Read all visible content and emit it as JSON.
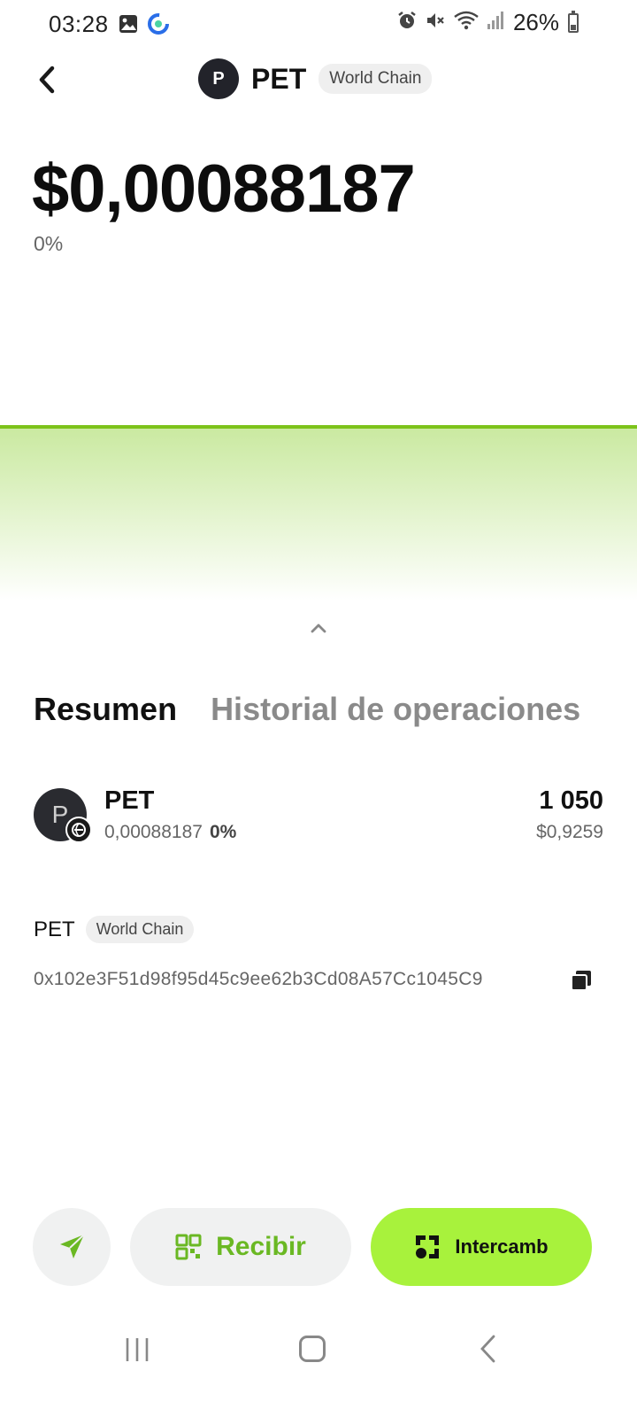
{
  "status_bar": {
    "time": "03:28",
    "battery": "26%",
    "icons": [
      "gallery-icon",
      "app-loader-icon",
      "alarm-icon",
      "mute-icon",
      "wifi-icon",
      "signal-icon",
      "battery-icon"
    ]
  },
  "header": {
    "avatar_letter": "P",
    "title": "PET",
    "chain": "World Chain"
  },
  "price": {
    "value": "$0,00088187",
    "change": "0%"
  },
  "chart": {
    "line_color": "#7cc31a",
    "fill_color": "#c7e89b",
    "trend": "flat"
  },
  "tabs": [
    {
      "label": "Resumen",
      "active": true
    },
    {
      "label": "Historial de operaciones",
      "active": false
    }
  ],
  "token": {
    "avatar_letter": "P",
    "name": "PET",
    "price": "0,00088187",
    "change": "0%",
    "amount": "1 050",
    "fiat": "$0,9259"
  },
  "contract": {
    "symbol": "PET",
    "chain": "World Chain",
    "address": "0x102e3F51d98f95d45c9ee62b3Cd08A57Cc1045C9"
  },
  "actions": {
    "receive_label": "Recibir",
    "swap_label": "Intercamb"
  },
  "colors": {
    "accent_green": "#a8f23c",
    "receive_green": "#6ab823"
  }
}
